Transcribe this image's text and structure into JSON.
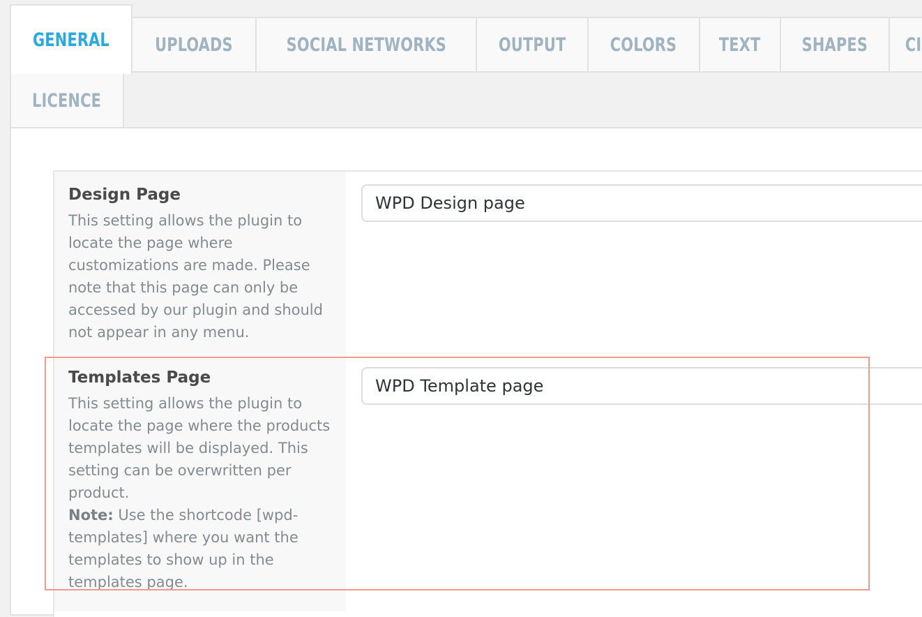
{
  "tabs": [
    {
      "label": "GENERAL",
      "active": true
    },
    {
      "label": "UPLOADS",
      "active": false
    },
    {
      "label": "SOCIAL NETWORKS",
      "active": false
    },
    {
      "label": "OUTPUT",
      "active": false
    },
    {
      "label": "COLORS",
      "active": false
    },
    {
      "label": "TEXT",
      "active": false
    },
    {
      "label": "SHAPES",
      "active": false
    },
    {
      "label": "CI",
      "active": false
    },
    {
      "label": "LICENCE",
      "active": false
    }
  ],
  "colors": {
    "active_tab": "#29a8e4",
    "inactive_tab": "#9fb3c0",
    "highlight_border": "#f4998b"
  },
  "settings": [
    {
      "title": "Design Page",
      "description": "This setting allows the plugin to locate the page where customizations are made. Please note that this page can only be accessed by our plugin and should not appear in any menu.",
      "value": "WPD Design page"
    },
    {
      "title": "Templates Page",
      "description": "This setting allows the plugin to locate the page where the products templates will be displayed. This setting can be overwritten per product.",
      "note_label": "Note:",
      "note_text": " Use the shortcode [wpd-templates] where you want the templates to show up in the templates page.",
      "value": "WPD Template page"
    }
  ]
}
